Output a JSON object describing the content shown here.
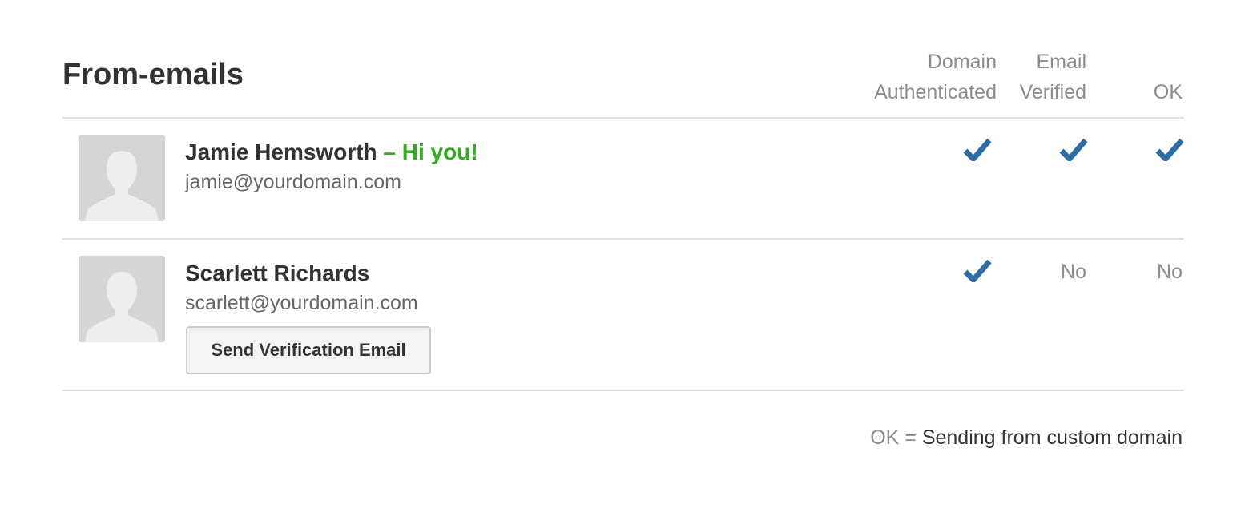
{
  "page": {
    "title": "From-emails"
  },
  "columns": {
    "domain_line1": "Domain",
    "domain_line2": "Authenticated",
    "email_line1": "Email",
    "email_line2": "Verified",
    "ok": "OK"
  },
  "rows": [
    {
      "name": "Jamie Hemsworth",
      "greeting": "– Hi you!",
      "email": "jamie@yourdomain.com",
      "avatar_icon": "person-silhouette-icon",
      "domain_authenticated": "check-icon",
      "email_verified": "check-icon",
      "ok": "check-icon"
    },
    {
      "name": "Scarlett Richards",
      "email": "scarlett@yourdomain.com",
      "avatar_icon": "person-silhouette-icon",
      "domain_authenticated": "check-icon",
      "email_verified": "No",
      "ok": "No",
      "button_label": "Send Verification Email"
    }
  ],
  "legend": {
    "key": "OK =",
    "value": "Sending from custom domain"
  },
  "colors": {
    "check": "#2e6da4",
    "greeting": "#33aa22",
    "text_dark": "#333333",
    "text_muted": "#8c8c8c",
    "avatar_bg": "#d4d6d6",
    "avatar_silhouette": "#eeeeee"
  }
}
